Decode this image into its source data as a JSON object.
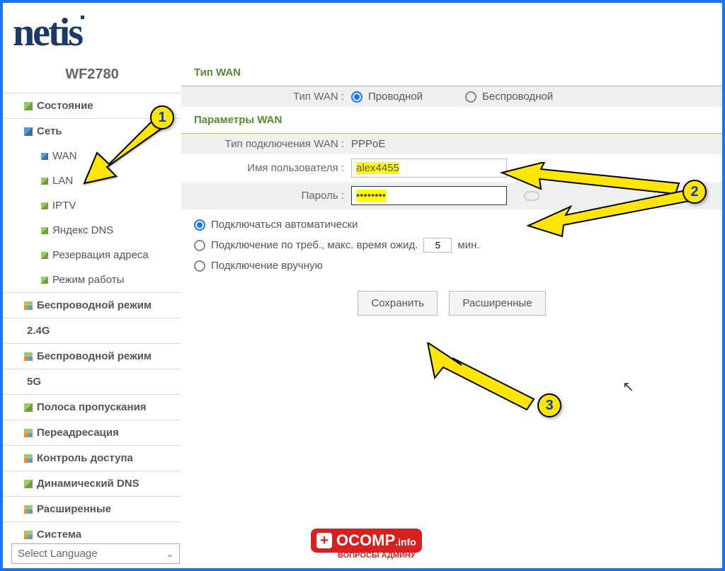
{
  "logo": "netis",
  "model": "WF2780",
  "sidebar": {
    "items": [
      {
        "label": "Состояние"
      },
      {
        "label": "Сеть"
      },
      {
        "label": "WAN"
      },
      {
        "label": "LAN"
      },
      {
        "label": "IPTV"
      },
      {
        "label": "Яндекс DNS"
      },
      {
        "label": "Резервация адреса"
      },
      {
        "label": "Режим работы"
      },
      {
        "label": "Беспроводной режим"
      },
      {
        "label": "2.4G"
      },
      {
        "label": "Беспроводной режим"
      },
      {
        "label": "5G"
      },
      {
        "label": "Полоса пропускания"
      },
      {
        "label": "Переадресация"
      },
      {
        "label": "Контроль доступа"
      },
      {
        "label": "Динамический DNS"
      },
      {
        "label": "Расширенные"
      },
      {
        "label": "Система"
      }
    ]
  },
  "lang_select": "Select Language",
  "sections": {
    "wan_type_title": "Тип WAN",
    "wan_params_title": "Параметры WAN",
    "wan_type_label": "Тип WAN :",
    "wired": "Проводной",
    "wireless": "Беспроводной",
    "conn_type_label": "Тип подключения WAN :",
    "conn_type_value": "PPPoE",
    "username_label": "Имя пользователя :",
    "username_value": "alex4455",
    "password_label": "Пароль :",
    "password_value": "••••••••",
    "auto_connect": "Подключаться автоматически",
    "on_demand_pre": "Подключение по треб., макс. время ожид.",
    "on_demand_val": "5",
    "on_demand_post": "мин.",
    "manual": "Подключение вручную",
    "save": "Сохранить",
    "advanced": "Расширенные"
  },
  "annotations": {
    "n1": "1",
    "n2": "2",
    "n3": "3"
  },
  "watermark": {
    "main": "OCOMP",
    "suffix": ".info",
    "sub": "ВОПРОСЫ АДМИНУ"
  }
}
